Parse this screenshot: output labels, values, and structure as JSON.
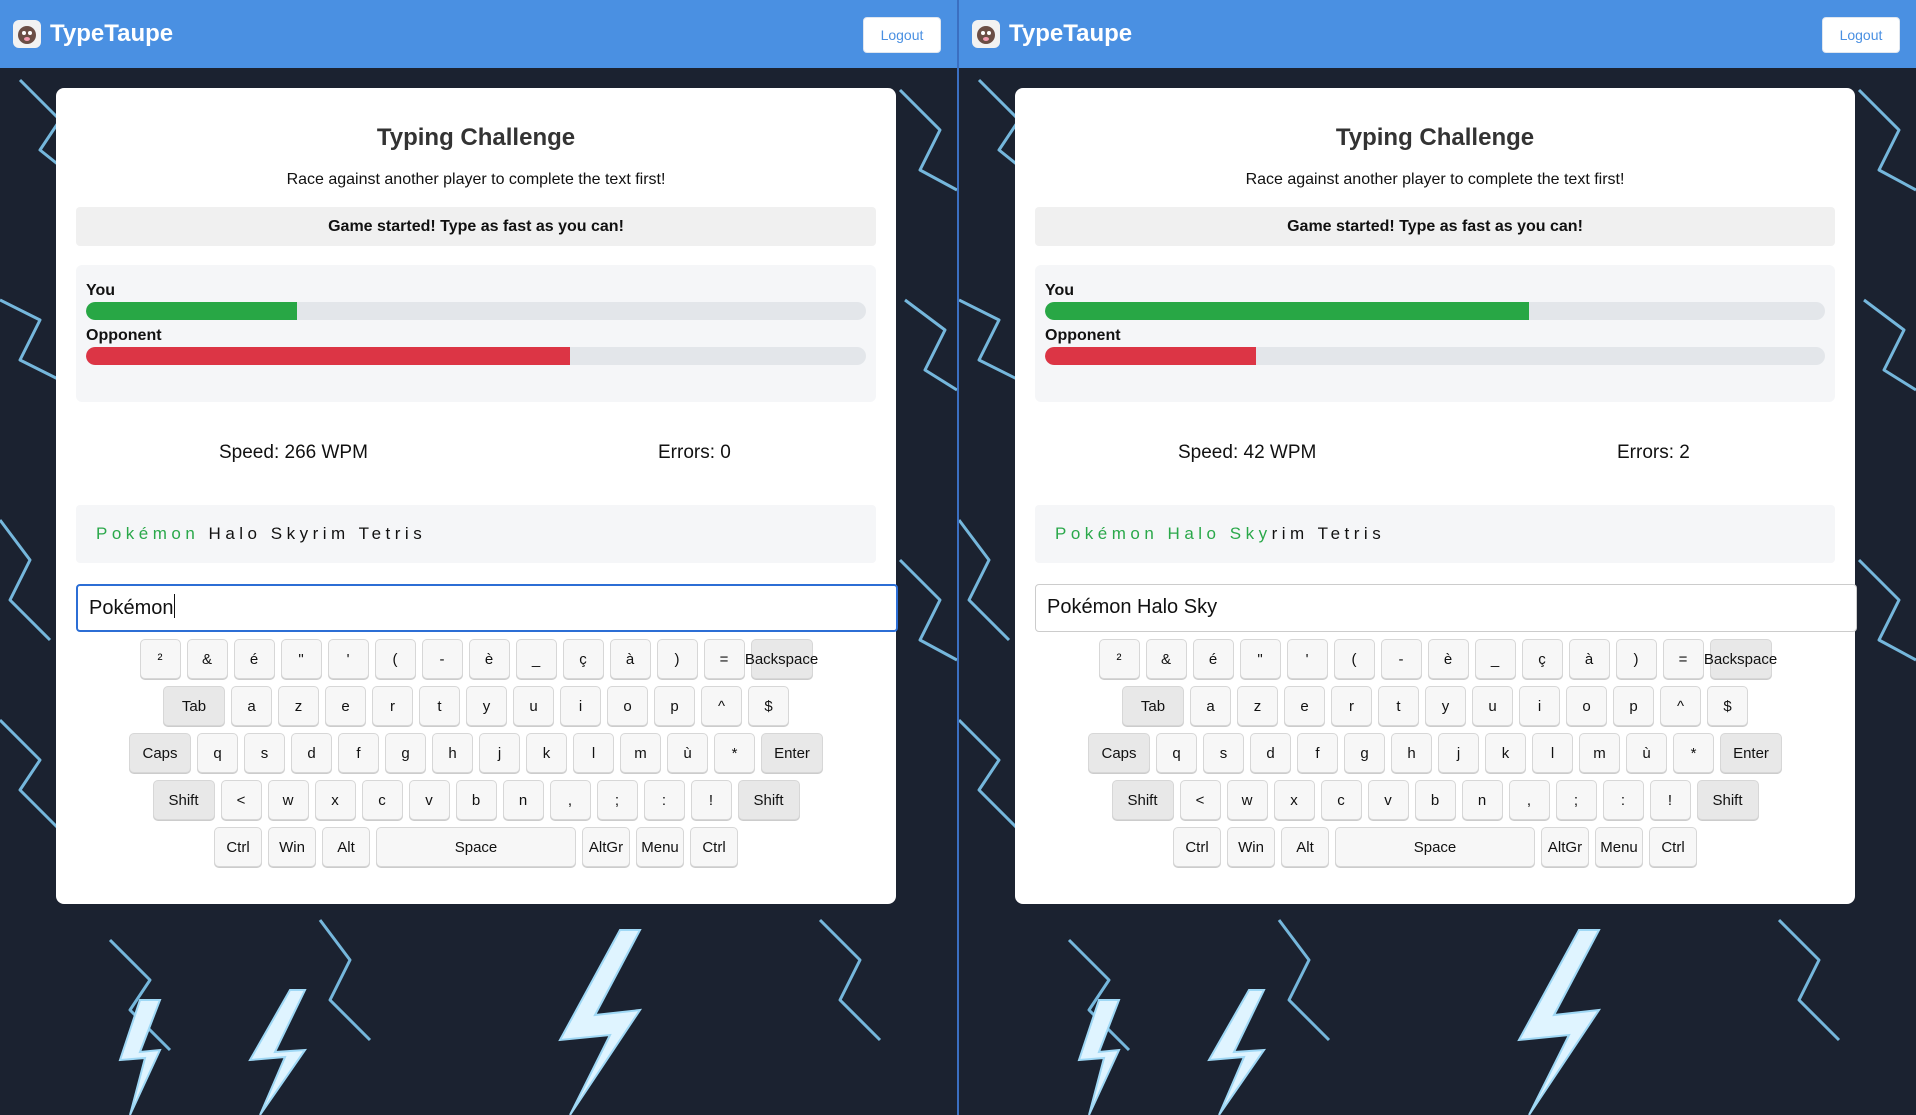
{
  "app": {
    "name": "TypeTaupe",
    "logout_label": "Logout"
  },
  "card": {
    "title": "Typing Challenge",
    "subtitle": "Race against another player to complete the text first!",
    "status": "Game started! Type as fast as you can!",
    "you_label": "You",
    "opponent_label": "Opponent"
  },
  "colors": {
    "navbar": "#4a90e2",
    "you_bar": "#28a745",
    "opponent_bar": "#dc3545",
    "typed_text": "#2aa84a",
    "background": "#1b2230"
  },
  "players": [
    {
      "you_progress": 0.27,
      "opponent_progress": 0.62,
      "speed": "Speed: 266 WPM",
      "errors": "Errors: 0",
      "text_typed": "Pokémon",
      "text_remaining": " Halo Skyrim Tetris",
      "input_value": "Pokémon",
      "input_focused": true
    },
    {
      "you_progress": 0.62,
      "opponent_progress": 0.27,
      "speed": "Speed: 42 WPM",
      "errors": "Errors: 2",
      "text_typed": "Pokémon Halo Sky",
      "text_remaining": "rim Tetris",
      "input_value": "Pokémon Halo Sky",
      "input_focused": false
    }
  ],
  "keyboard": {
    "rows": [
      [
        {
          "label": "²"
        },
        {
          "label": "&"
        },
        {
          "label": "é"
        },
        {
          "label": "\""
        },
        {
          "label": "'"
        },
        {
          "label": "("
        },
        {
          "label": "-"
        },
        {
          "label": "è"
        },
        {
          "label": "_"
        },
        {
          "label": "ç"
        },
        {
          "label": "à"
        },
        {
          "label": ")"
        },
        {
          "label": "="
        },
        {
          "label": "Backspace",
          "w": "wide",
          "mod": true
        }
      ],
      [
        {
          "label": "Tab",
          "w": "tab",
          "mod": true
        },
        {
          "label": "a"
        },
        {
          "label": "z"
        },
        {
          "label": "e"
        },
        {
          "label": "r"
        },
        {
          "label": "t"
        },
        {
          "label": "y"
        },
        {
          "label": "u"
        },
        {
          "label": "i"
        },
        {
          "label": "o"
        },
        {
          "label": "p"
        },
        {
          "label": "^"
        },
        {
          "label": "$"
        }
      ],
      [
        {
          "label": "Caps",
          "w": "caps",
          "mod": true
        },
        {
          "label": "q"
        },
        {
          "label": "s"
        },
        {
          "label": "d"
        },
        {
          "label": "f"
        },
        {
          "label": "g"
        },
        {
          "label": "h"
        },
        {
          "label": "j"
        },
        {
          "label": "k"
        },
        {
          "label": "l"
        },
        {
          "label": "m"
        },
        {
          "label": "ù"
        },
        {
          "label": "*"
        },
        {
          "label": "Enter",
          "w": "enter",
          "mod": true
        }
      ],
      [
        {
          "label": "Shift",
          "w": "shift",
          "mod": true
        },
        {
          "label": "<"
        },
        {
          "label": "w"
        },
        {
          "label": "x"
        },
        {
          "label": "c"
        },
        {
          "label": "v"
        },
        {
          "label": "b"
        },
        {
          "label": "n"
        },
        {
          "label": ","
        },
        {
          "label": ";"
        },
        {
          "label": ":"
        },
        {
          "label": "!"
        },
        {
          "label": "Shift",
          "w": "shift",
          "mod": true
        }
      ],
      [
        {
          "label": "Ctrl",
          "w": "ctrl"
        },
        {
          "label": "Win",
          "w": "ctrl"
        },
        {
          "label": "Alt",
          "w": "ctrl"
        },
        {
          "label": "Space",
          "w": "space"
        },
        {
          "label": "AltGr",
          "w": "ctrl"
        },
        {
          "label": "Menu",
          "w": "ctrl"
        },
        {
          "label": "Ctrl",
          "w": "ctrl"
        }
      ]
    ]
  }
}
